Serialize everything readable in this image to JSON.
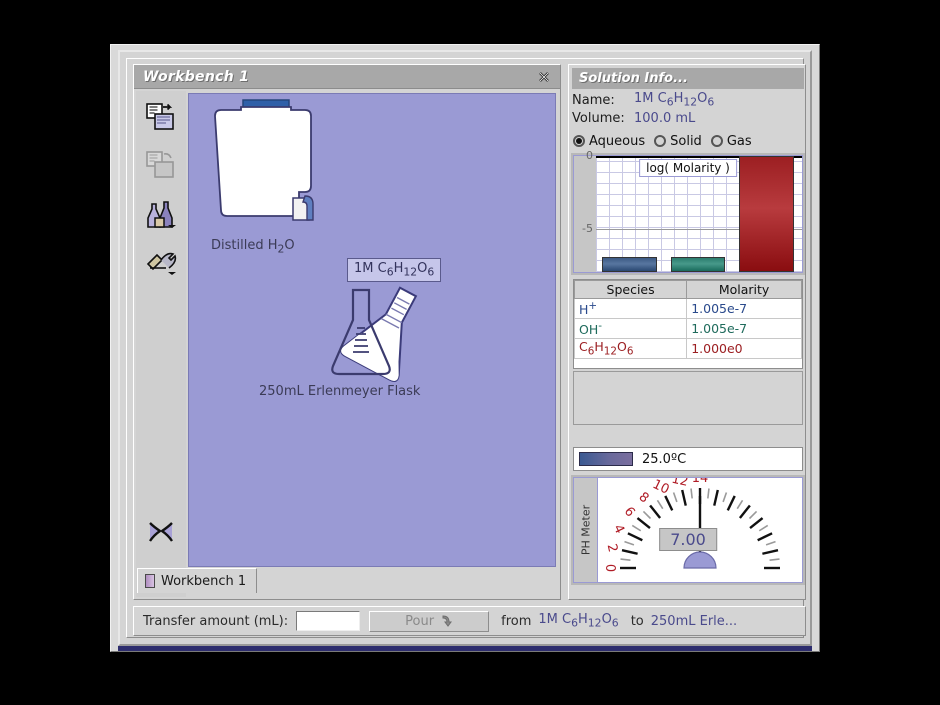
{
  "window": {
    "workbench_title": "Workbench 1",
    "close_icon": "close-x-icon"
  },
  "toolbar": {
    "items": [
      {
        "name": "new-experiment-icon",
        "label": "New Experiment"
      },
      {
        "name": "copy-document-icon",
        "label": "Copy"
      },
      {
        "name": "chemicals-bottles-icon",
        "label": "Chemicals"
      },
      {
        "name": "tools-wrench-icon",
        "label": "Tools"
      },
      {
        "name": "connector-icon",
        "label": "Connector"
      }
    ]
  },
  "canvas": {
    "objects": [
      {
        "name": "distilled-water-bottle",
        "label": "Distilled H2O",
        "label_html": "Distilled H<sub>2</sub>O"
      },
      {
        "name": "erlenmeyer-flask",
        "label": "250mL Erlenmeyer Flask"
      }
    ],
    "selection_label": "1M C6H12O6"
  },
  "tab": {
    "label": "Workbench 1"
  },
  "info": {
    "title": "Solution Info...",
    "name_key": "Name:",
    "name_value": "1M C6H12O6",
    "volume_key": "Volume:",
    "volume_value": "100.0 mL",
    "phases": [
      {
        "label": "Aqueous",
        "selected": true
      },
      {
        "label": "Solid",
        "selected": false
      },
      {
        "label": "Gas",
        "selected": false
      }
    ]
  },
  "chart_data": {
    "type": "bar",
    "title": "log( Molarity )",
    "categories": [
      "H+",
      "OH-",
      "C6H12O6"
    ],
    "values": [
      -6.998,
      -6.998,
      0.0
    ],
    "colors": [
      "#3c5a84",
      "#2b7d6e",
      "#9c1f22"
    ],
    "ylabel": "",
    "xlabel": "",
    "ylim": [
      -8,
      0
    ],
    "yticks": [
      0,
      -5
    ],
    "ytick_labels": [
      "0",
      "-5"
    ],
    "grid": true,
    "legend": "none"
  },
  "species_table": {
    "headers": [
      "Species",
      "Molarity"
    ],
    "rows": [
      {
        "species": "H+",
        "molarity": "1.005e-7",
        "color_class": "sp-h"
      },
      {
        "species": "OH-",
        "molarity": "1.005e-7",
        "color_class": "sp-oh"
      },
      {
        "species": "C6H12O6",
        "molarity": "1.000e0",
        "color_class": "sp-gl"
      }
    ]
  },
  "temperature": {
    "value": "25.0ºC"
  },
  "ph_meter": {
    "side_label": "PH Meter",
    "reading": "7.00",
    "tick_labels": [
      "0",
      "2",
      "4",
      "6",
      "8",
      "10",
      "12",
      "14"
    ],
    "min": 0,
    "max": 14
  },
  "transfer": {
    "label": "Transfer amount (mL):",
    "input_value": "",
    "input_placeholder": "",
    "pour_label": "Pour",
    "pour_icon": "pour-arrow-icon",
    "from_word": "from",
    "from_value": "1M C6H12O6",
    "to_word": "to",
    "to_value": "250mL Erle..."
  }
}
